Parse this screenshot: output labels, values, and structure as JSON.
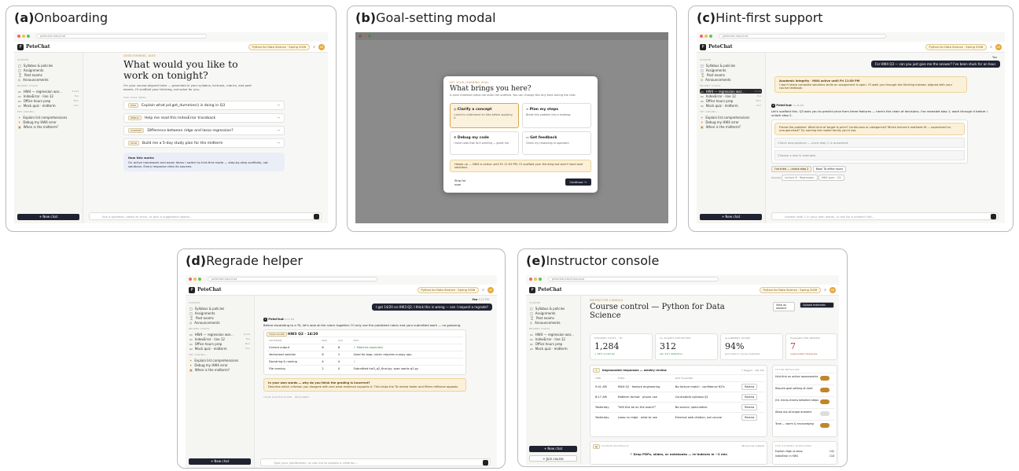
{
  "panels": {
    "a": {
      "letter": "(a)",
      "title": "Onboarding"
    },
    "b": {
      "letter": "(b)",
      "title": "Goal-setting modal"
    },
    "c": {
      "letter": "(c)",
      "title": "Hint-first support"
    },
    "d": {
      "letter": "(d)",
      "title": "Regrade helper"
    },
    "e": {
      "letter": "(e)",
      "title": "Instructor console"
    }
  },
  "app": {
    "url": "petechat.edu/chat",
    "url_instructor": "petechat.edu/instructor",
    "name": "PeteChat",
    "logo": "P",
    "course": "Python for Data Science · Spring 2026",
    "avatar": "AR",
    "search_icon": "search-icon",
    "new_chat": "+ New chat",
    "composer_placeholder": "Ask a question, paste an error, or pick a suggestion above...",
    "colors": {
      "accent": "#c0862a",
      "dark": "#1f2230",
      "amber_bg": "#fbf0d9",
      "blue_note": "#e9eef7"
    }
  },
  "sidebar": {
    "course_label": "COURSE",
    "course_items": [
      "Syllabus & policies",
      "Assignments",
      "Past exams",
      "Announcements"
    ],
    "recent_label": "RECENT CHATS",
    "recent": [
      {
        "label": "HW4 — regression war...",
        "time": "11:24"
      },
      {
        "label": "IndexError · line 12",
        "time": "Tue"
      },
      {
        "label": "Office hours prep",
        "time": "Mon"
      },
      {
        "label": "Mock quiz · midterm",
        "time": "Sun"
      }
    ],
    "try_label": "TRY ASKING...",
    "try_items": [
      "Explain list comprehensions",
      "Debug my HW4 error",
      "When is the midterm?"
    ]
  },
  "onboarding": {
    "eyebrow": "GOOD EVENING, ALEX",
    "heading": "What would you like to work on tonight?",
    "sub": "I'm your course-aligned tutor — grounded in your syllabus, lectures, rubrics, and past exams. I'll scaffold your thinking, not solve for you.",
    "for_label": "FOR YOUR WEEK",
    "suggestions": [
      {
        "tag": "HW4",
        "text": "Explain what pd.get_dummies() is doing in Q3"
      },
      {
        "tag": "DEBUG",
        "text": "Help me read this IndexError traceback"
      },
      {
        "tag": "CONCEPT",
        "text": "Difference between ridge and lasso regression?"
      },
      {
        "tag": "PLAN",
        "text": "Build me a 5-day study plan for the midterm"
      }
    ],
    "how_title": "How this works",
    "how_text": "On active homework and exam items I switch to hint-first mode — step-by-step scaffolds, not solutions. Every response cites its sources."
  },
  "modal": {
    "eyebrow": "SET YOUR LEARNING GOAL",
    "title": "What brings you here?",
    "sub": "A clear intention helps me tailor the scaffold. You can change this any time during the chat.",
    "cards": [
      {
        "title": "Clarify a concept",
        "text": "I want to understand an idea before applying it."
      },
      {
        "title": "Plan my steps",
        "text": "Break this problem into a strategy."
      },
      {
        "title": "Debug my code",
        "text": "I have code that isn't working — guide me."
      },
      {
        "title": "Get feedback",
        "text": "Check my reasoning or approach."
      }
    ],
    "notice": "Heads up — HW4 is active until Fri 11:59 PM. I'll scaffold your thinking but won't hand over solutions.",
    "skip": "Skip for now",
    "continue": "Continue →"
  },
  "hint": {
    "user_msg": "For HW4 Q3 — can you just give me the answer? I've been stuck for an hour.",
    "you": "You",
    "integrity_title": "Academic integrity · HW4 active until Fri 11:59 PM",
    "integrity_text": "I won't share complete solutions while an assignment is open. I'll walk you through the thinking instead, aligned with your course textbook.",
    "bot_name": "PeteChat",
    "bot_time": "11:26 PM",
    "intro": "Let's scaffold this. Q3 asks you to predict price from three features — here's the chain of decisions. I've revealed step 1; work through it before I unlock step 2.",
    "step1": "Frame the problem: What kind of target is price? Continuous or categorical? Which lecture's methods fit — supervised vs. unsupervised? Try naming the model family you'd use.",
    "step2": "Check assumptions — once step 1 is answered.",
    "step3": "Choose a loss & evaluate.",
    "unlock": "I've tried — unlock step 2",
    "book": "Book TA office hours",
    "sources_label": "Sources",
    "sources": [
      "Lecture 8 · Regression",
      "HW4 spec · Q3"
    ],
    "composer": "Answer step 1 in your own words, or ask for a smaller hint..."
  },
  "regrade": {
    "user_msg": "I got 14/20 on HW3 Q2. I think this is wrong — can I request a regrade?",
    "you": "You",
    "time": "9:12 PM",
    "bot_name": "PeteChat",
    "bot_time": "9:13 PM",
    "intro": "Before escalating to a TA, let's look at the rubric together. I'll only use the published rubric and your submitted work — no guessing.",
    "score_tag": "YOUR SCORE",
    "score_title": "HW3 Q2 · 14/20",
    "cols": [
      "CRITERION",
      "MAX",
      "YOU",
      "WHY"
    ],
    "rows": [
      [
        "Correct output",
        "8",
        "8",
        "✓ Matches expected."
      ],
      [
        "Vectorized solution",
        "6",
        "2",
        "Used for-loop; rubric requires numpy ops."
      ],
      [
        "Docstring & naming",
        "4",
        "4",
        "✓"
      ],
      [
        "File naming",
        "2",
        "0",
        "Submitted hw3_q2_final.py; spec wants q2.py"
      ]
    ],
    "prompt_title": "In your own words — why do you think the grading is incorrect?",
    "prompt_text": "Describe which criterion you disagree with and what evidence supports it. This helps the TA review faster and filters reflexive appeals.",
    "just_label": "YOUR JUSTIFICATION · REQUIRED",
    "composer": "Type your justification, or ask me to explain a criterion..."
  },
  "instructor": {
    "eyebrow": "INSTRUCTOR CONSOLE",
    "title": "Course control — Python for Data Science",
    "view_student": "View as student",
    "upload": "Upload materials",
    "stats": [
      {
        "k": "STUDENT CHATS · 7D",
        "v": "1,284",
        "s": "+ 18% vs last wk"
      },
      {
        "k": "TA TICKETS DEFLECTED",
        "v": "312",
        "s": "est. 41% deflection"
      },
      {
        "k": "ALIGNMENT SCORE",
        "v": "94%",
        "s": "grounded in course materials"
      },
      {
        "k": "FLAGGED FOR REVIEW",
        "v": "7",
        "s": "ungrounded responses"
      }
    ],
    "queue_title": "Ungrounded responses — weekly review",
    "queue_badge": "7 flagged · last 24h",
    "cols": [
      "TIME",
      "TOPIC",
      "WHY FLAGGED"
    ],
    "rows": [
      [
        "9:41 AM",
        "HW4 Q2 · feature engineering",
        "No lecture match · confidence 62%"
      ],
      [
        "8:17 AM",
        "Midterm format · phone use",
        "Contradicts syllabus §3"
      ],
      [
        "Yesterday",
        "\"Will this be on the exam?\"",
        "No source; speculative"
      ],
      [
        "Yesterday",
        "Lasso vs ridge · what to use",
        "External web citation, not course"
      ]
    ],
    "review": "Review",
    "tutor_label": "TUTOR BEHAVIOR",
    "toggles": [
      {
        "label": "Hint-first on active assessments",
        "on": true
      },
      {
        "label": "Require goal-setting at start",
        "on": true
      },
      {
        "label": "JOL micro-checks between steps",
        "on": true
      },
      {
        "label": "Allow out-of-scope answers",
        "on": false
      },
      {
        "label": "Tone — warm & encouraging",
        "on": true
      }
    ],
    "materials_label": "COURSE MATERIALS",
    "materials_count": "48 sources indexed",
    "drop": "Drop PDFs, slides, or notebooks — re-indexes in ~2 min",
    "questions_label": "TOP STUDENT QUESTIONS",
    "questions": [
      [
        "Explain ridge vs lasso",
        "142"
      ],
      [
        "IndexError in HW4",
        "118"
      ]
    ],
    "join": "+ Join course"
  }
}
